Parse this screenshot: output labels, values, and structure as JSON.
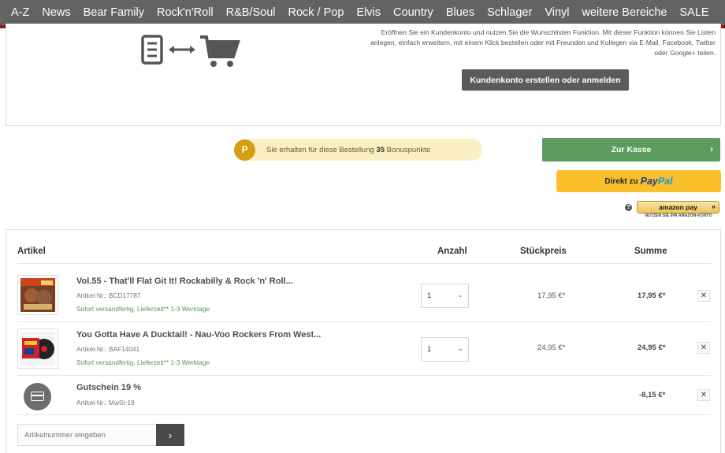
{
  "nav": {
    "items": [
      "A-Z",
      "News",
      "Bear Family",
      "Rock'n'Roll",
      "R&B/Soul",
      "Rock / Pop",
      "Elvis",
      "Country",
      "Blues",
      "Schlager",
      "Vinyl",
      "weitere Bereiche",
      "SALE"
    ]
  },
  "promo": {
    "text": "Eröffnen Sie ein Kundenkonto und nutzen Sie die Wunschlisten Funktion. Mit dieser Funktion können Sie Listen anlegen, einfach erweitern, mit einem Klick bestellen oder mit Freunden und Kollegen via E-Mail, Facebook, Twitter oder Google+ teilen.",
    "login_button": "Kundenkonto erstellen oder anmelden"
  },
  "bonus": {
    "badge": "P",
    "prefix": "Sie erhalten für diese Bestellung ",
    "points": "35",
    "suffix": " Bonuspunkte"
  },
  "checkout": {
    "button": "Zur Kasse",
    "paypal_prefix": "Direkt zu",
    "paypal_brand_1": "Pay",
    "paypal_brand_2": "Pal",
    "amazon_label": "amazon pay",
    "amazon_sub": "NUTZEN SIE IHR AMAZON-KONTO",
    "help": "?"
  },
  "cart": {
    "headers": {
      "article": "Artikel",
      "qty": "Anzahl",
      "unit_price": "Stückpreis",
      "sum": "Summe"
    },
    "items": [
      {
        "name": "Vol.55 - That'll Flat Git It! Rockabilly & Rock 'n' Roll...",
        "article_no": "Artikel-Nr.: BCD17787",
        "shipping": "Sofort versandfertig, Lieferzeit** 1-3 Werktage",
        "qty": "1",
        "unit_price": "17,95 €*",
        "total": "17,95 €*"
      },
      {
        "name": "You Gotta Have A Ducktail! - Nau-Voo Rockers From West...",
        "article_no": "Artikel-Nr.: BAF14041",
        "shipping": "Sofort versandfertig, Lieferzeit** 1-3 Werktage",
        "qty": "1",
        "unit_price": "24,95 €*",
        "total": "24,95 €*"
      }
    ],
    "voucher": {
      "name": "Gutschein 19 %",
      "article_no": "Artikel-Nr.: MwSt-19",
      "total": "-8,15 €*"
    },
    "add_article_placeholder": "Artikelnummer eingeben"
  }
}
